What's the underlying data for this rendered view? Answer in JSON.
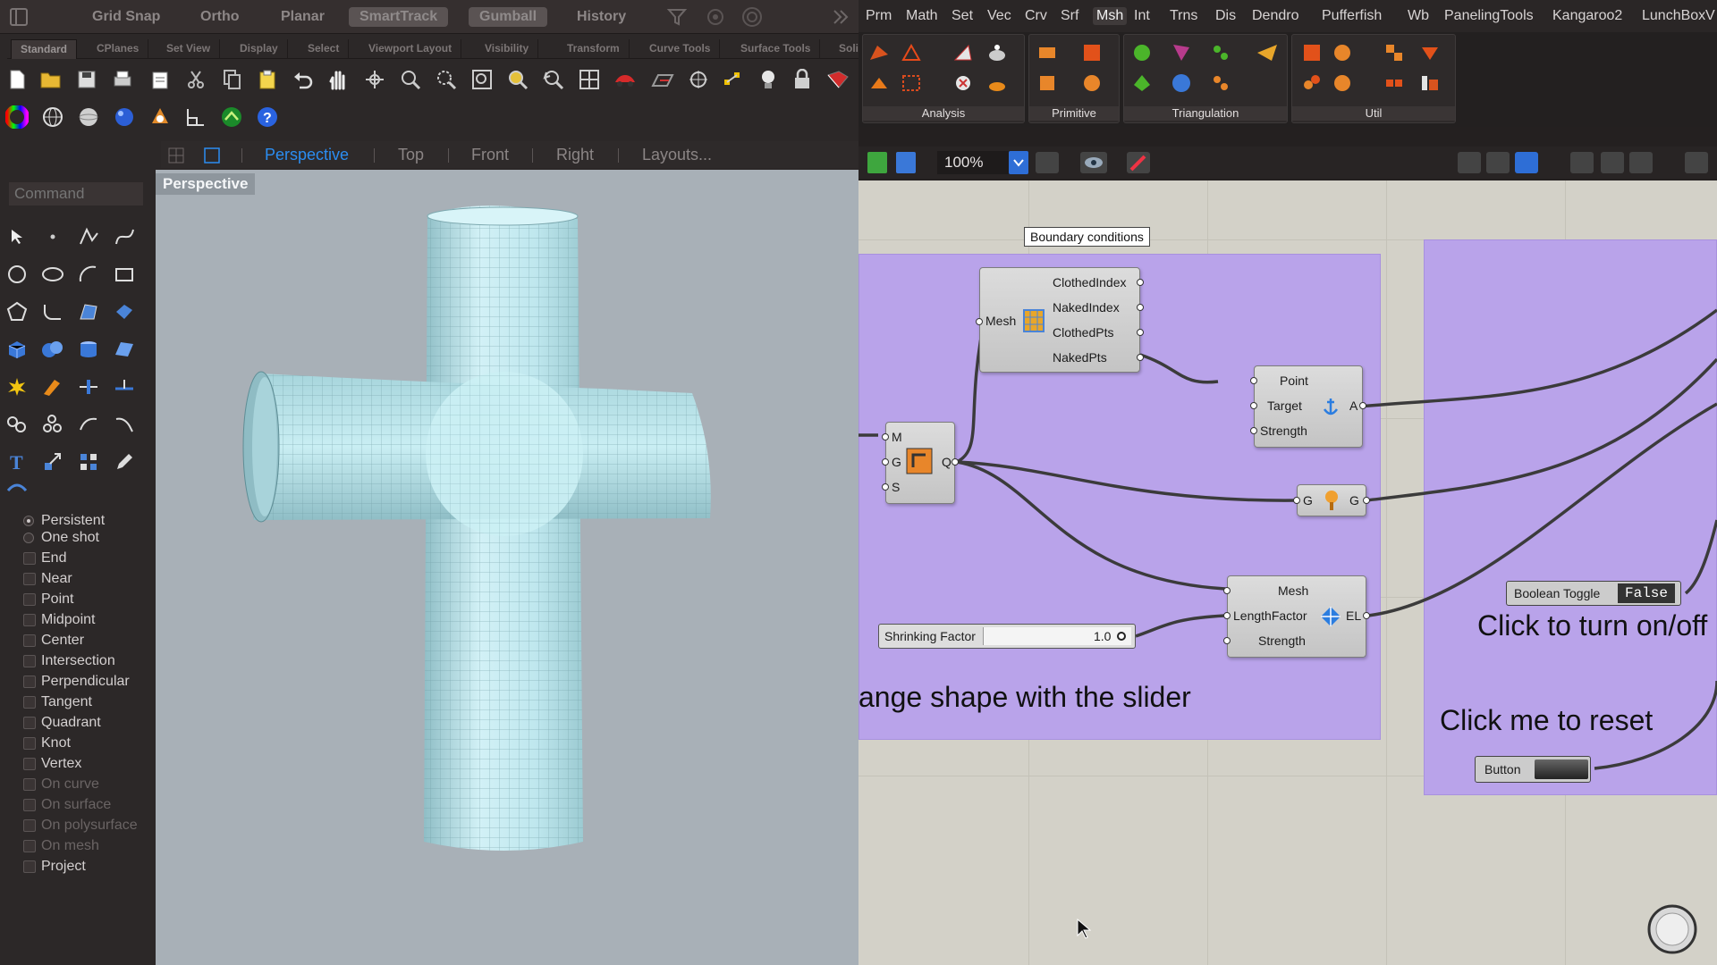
{
  "rhino": {
    "topbar": {
      "grid_snap": "Grid Snap",
      "ortho": "Ortho",
      "planar": "Planar",
      "smarttrack": "SmartTrack",
      "gumball": "Gumball",
      "history": "History"
    },
    "tabs": [
      "Standard",
      "CPlanes",
      "Set View",
      "Display",
      "Select",
      "Viewport Layout",
      "Visibility",
      "Transform",
      "Curve Tools",
      "Surface Tools",
      "Soli"
    ],
    "viewtabs": {
      "perspective": "Perspective",
      "top": "Top",
      "front": "Front",
      "right": "Right",
      "layouts": "Layouts..."
    },
    "command_placeholder": "Command",
    "viewport_label": "Perspective",
    "osnap": {
      "persistent": "Persistent",
      "one_shot": "One shot",
      "items": [
        "End",
        "Near",
        "Point",
        "Midpoint",
        "Center",
        "Intersection",
        "Perpendicular",
        "Tangent",
        "Quadrant",
        "Knot",
        "Vertex"
      ],
      "dim_items": [
        "On curve",
        "On surface",
        "On polysurface",
        "On mesh"
      ],
      "project": "Project"
    },
    "mesh_color": "#bfe7ee"
  },
  "grasshopper": {
    "menus": [
      "Prm",
      "Math",
      "Set",
      "Vec",
      "Crv",
      "Srf",
      "Msh",
      "Int",
      "Trns",
      "Dis",
      "Dendro",
      "Pufferfish",
      "Wb",
      "PanelingTools",
      "Kangaroo2",
      "LunchBox",
      "V"
    ],
    "active_menu": "Msh",
    "ribbon_groups": [
      "Analysis",
      "Primitive",
      "Triangulation",
      "Util"
    ],
    "zoom": "100%",
    "canvas": {
      "group_color": "#b9a3ea",
      "note_boundary": "Boundary conditions",
      "naked": {
        "input": "Mesh",
        "outputs": [
          "ClothedIndex",
          "NakedIndex",
          "ClothedPts",
          "NakedPts"
        ]
      },
      "anchor": {
        "inputs": [
          "Point",
          "Target",
          "Strength"
        ],
        "output": "A"
      },
      "mq": {
        "inputs": [
          "M",
          "G",
          "S"
        ],
        "output": "Q"
      },
      "show": {
        "input": "G",
        "output": "G"
      },
      "edge": {
        "inputs": [
          "Mesh",
          "LengthFactor",
          "Strength"
        ],
        "output": "EL"
      },
      "slider": {
        "label": "Shrinking Factor",
        "value": "1.0"
      },
      "text_slider": "ange shape with the slider",
      "toggle": {
        "label": "Boolean Toggle",
        "value": "False"
      },
      "text_toggle": "Click to turn on/off",
      "text_reset": "Click me to reset",
      "button": {
        "label": "Button"
      }
    }
  }
}
